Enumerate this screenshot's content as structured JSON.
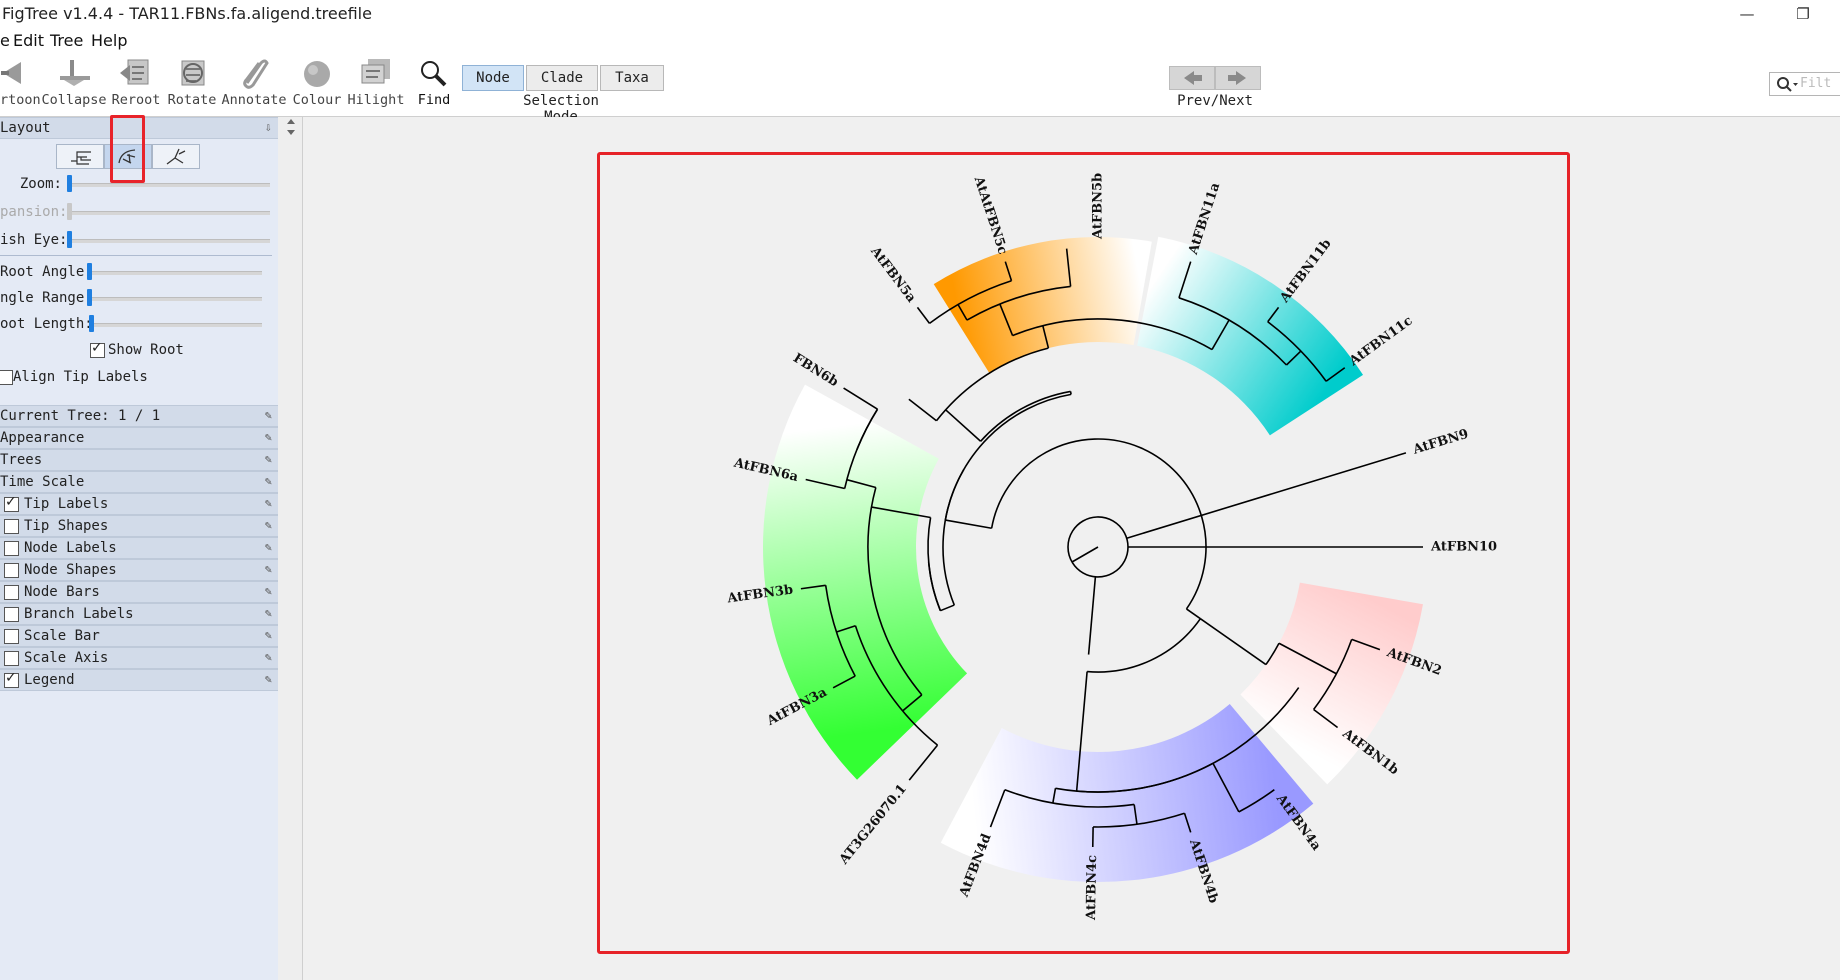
{
  "window": {
    "title": "FigTree v1.4.4 - TAR11.FBNs.fa.aligend.treefile",
    "min_glyph": "—",
    "restore_glyph": "❐"
  },
  "menu": [
    "e",
    "Edit",
    "Tree",
    "Help"
  ],
  "toolbar": {
    "tools": [
      {
        "label": "rtoon",
        "icon": "cartoon-icon"
      },
      {
        "label": "Collapse",
        "icon": "collapse-icon"
      },
      {
        "label": "Reroot",
        "icon": "reroot-icon"
      },
      {
        "label": "Rotate",
        "icon": "rotate-icon"
      },
      {
        "label": "Annotate",
        "icon": "annotate-icon"
      },
      {
        "label": "Colour",
        "icon": "colour-icon"
      },
      {
        "label": "Hilight",
        "icon": "hilight-icon"
      },
      {
        "label": "Find",
        "icon": "find-icon"
      }
    ],
    "selection_modes": [
      "Node",
      "Clade",
      "Taxa"
    ],
    "selected_mode": "Node",
    "selection_mode_label": "Selection Mode",
    "prevnext_label": "Prev/Next",
    "search_placeholder": "Filt"
  },
  "panel": {
    "layout_title": "Layout",
    "layout_buttons": [
      "rectangle-layout-icon",
      "polar-layout-icon",
      "radial-layout-icon"
    ],
    "selected_layout": 1,
    "sliders": [
      {
        "label": "Zoom:",
        "value": 0.0,
        "enabled": true
      },
      {
        "label": "pansion:",
        "value": 0.0,
        "enabled": false
      },
      {
        "label": "ish Eye:",
        "value": 0.0,
        "enabled": true
      },
      {
        "label": "Root Angle:",
        "value": 0.0,
        "enabled": true
      },
      {
        "label": "ngle Range:",
        "value": 0.0,
        "enabled": true
      },
      {
        "label": "oot Length:",
        "value": 0.01,
        "enabled": true
      }
    ],
    "show_root": {
      "label": "Show Root",
      "checked": true
    },
    "align_tip_labels": {
      "label": "Align Tip Labels",
      "checked": false
    },
    "current_tree": "Current Tree: 1 / 1",
    "sections": [
      {
        "label": "Appearance",
        "checkbox": false
      },
      {
        "label": "Trees",
        "checkbox": false
      },
      {
        "label": "Time Scale",
        "checkbox": false
      },
      {
        "label": "Tip Labels",
        "checkbox": true,
        "checked": true
      },
      {
        "label": "Tip Shapes",
        "checkbox": true,
        "checked": false
      },
      {
        "label": "Node Labels",
        "checkbox": true,
        "checked": false
      },
      {
        "label": "Node Shapes",
        "checkbox": true,
        "checked": false
      },
      {
        "label": "Node Bars",
        "checkbox": true,
        "checked": false
      },
      {
        "label": "Branch Labels",
        "checkbox": true,
        "checked": false
      },
      {
        "label": "Scale Bar",
        "checkbox": true,
        "checked": false
      },
      {
        "label": "Scale Axis",
        "checkbox": true,
        "checked": false
      },
      {
        "label": "Legend",
        "checkbox": true,
        "checked": true
      }
    ]
  },
  "tree": {
    "tips": [
      "AtFBN10",
      "AtFBN9",
      "AtFBN11c",
      "AtFBN11b",
      "AtFBN11a",
      "AtFBN5b",
      "AtAtFBN5c",
      "AtFBN5a",
      "FBN6b",
      "AtFBN6a",
      "AtFBN3b",
      "AtFBN3a",
      "AT3G26070.1",
      "AtFBN4d",
      "AtFBN4c",
      "AtFBN4b",
      "AtFBN4a",
      "AtFBN1b",
      "AtFBN2"
    ],
    "clade_colors": {
      "fbn11": "#00cccc",
      "fbn5": "#ff9900",
      "fbn6_3": "#33ff33",
      "fbn4": "#9999ff",
      "fbn1_2": "#ffcccc"
    }
  }
}
